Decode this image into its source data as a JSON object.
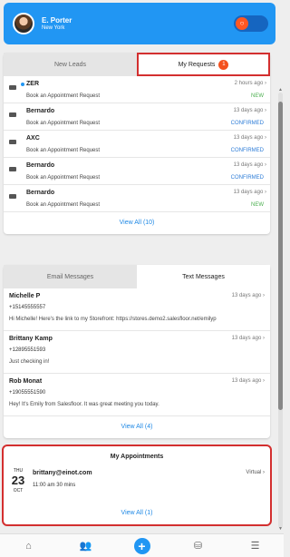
{
  "header": {
    "user_name": "E. Porter",
    "city": "New York",
    "status_toggle_icon": "power-icon"
  },
  "leads": {
    "tabs": [
      {
        "label": "New Leads"
      },
      {
        "label": "My Requests",
        "badge": "1"
      }
    ],
    "items": [
      {
        "name": "ZER",
        "request": "Book an Appointment Request",
        "time": "2 hours ago",
        "status": "NEW"
      },
      {
        "name": "Bernardo",
        "request": "Book an Appointment Request",
        "time": "13 days ago",
        "status": "CONFIRMED"
      },
      {
        "name": "AXC",
        "request": "Book an Appointment Request",
        "time": "13 days ago",
        "status": "CONFIRMED"
      },
      {
        "name": "Bernardo",
        "request": "Book an Appointment Request",
        "time": "13 days ago",
        "status": "CONFIRMED"
      },
      {
        "name": "Bernardo",
        "request": "Book an Appointment Request",
        "time": "13 days ago",
        "status": "NEW"
      }
    ],
    "view_all": "View All (10)"
  },
  "messages": {
    "tabs": [
      {
        "label": "Email Messages"
      },
      {
        "label": "Text Messages"
      }
    ],
    "items": [
      {
        "name": "Michelle P",
        "phone": "+15145555557",
        "text": "Hi Michelle! Here's the link to my Storefront: https://stores.demo2.salesfloor.net/emilyp",
        "time": "13 days ago"
      },
      {
        "name": "Brittany Kamp",
        "phone": "+12895551593",
        "text": "Just checking in!",
        "time": "13 days ago"
      },
      {
        "name": "Rob Monat",
        "phone": "+19055551590",
        "text": "Hey! It's Emily from Salesfloor. It was great meeting you today.",
        "time": "13 days ago"
      }
    ],
    "view_all": "View All (4)"
  },
  "appointments": {
    "title": "My Appointments",
    "items": [
      {
        "dow": "THU",
        "day": "23",
        "month": "OCT",
        "email": "brittany@einot.com",
        "time": "11:00 am  30 mins",
        "type": "Virtual"
      }
    ],
    "view_all": "View All (1)"
  },
  "nav": [
    "home-icon",
    "customers-icon",
    "add-icon",
    "store-icon",
    "menu-icon"
  ],
  "colors": {
    "accent": "#2196f3",
    "highlight": "#d32f2f",
    "badge": "#f4511e",
    "new_status": "#4caf50",
    "confirmed_status": "#2e7dd7"
  }
}
